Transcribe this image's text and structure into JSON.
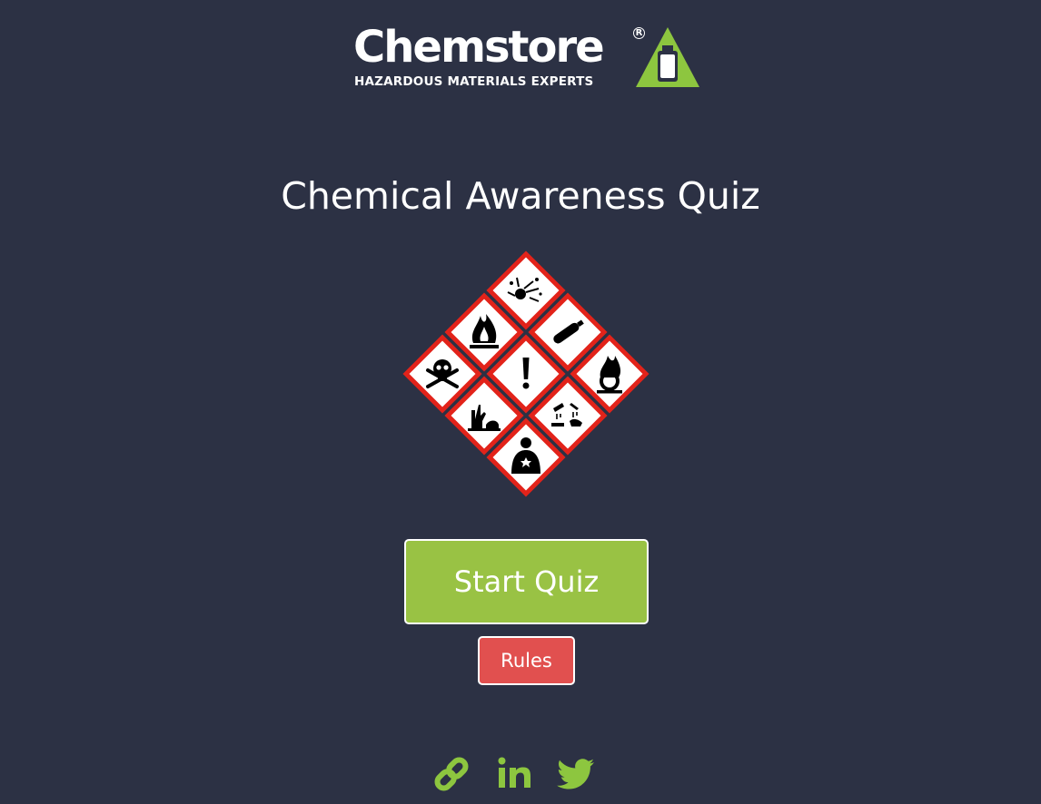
{
  "logo": {
    "wordmark": "Chemstore",
    "registered": "R",
    "tagline": "HAZARDOUS MATERIALS EXPERTS",
    "accent_color": "#8dc63f"
  },
  "title": "Chemical Awareness Quiz",
  "hazard_pictograms": [
    "exploding-bomb",
    "flame",
    "gas-cylinder",
    "skull-and-crossbones",
    "exclamation-mark",
    "flame-over-circle",
    "environment",
    "corrosion",
    "health-hazard"
  ],
  "buttons": {
    "start_label": "Start Quiz",
    "start_color": "#99c244",
    "rules_label": "Rules",
    "rules_color": "#e1504f"
  },
  "social": {
    "icons": [
      "link-icon",
      "linkedin-icon",
      "twitter-icon"
    ],
    "linkedin_label": "in",
    "icon_color": "#8dc63f"
  },
  "colors": {
    "background": "#2c3144",
    "pictogram_border": "#e2231a"
  }
}
